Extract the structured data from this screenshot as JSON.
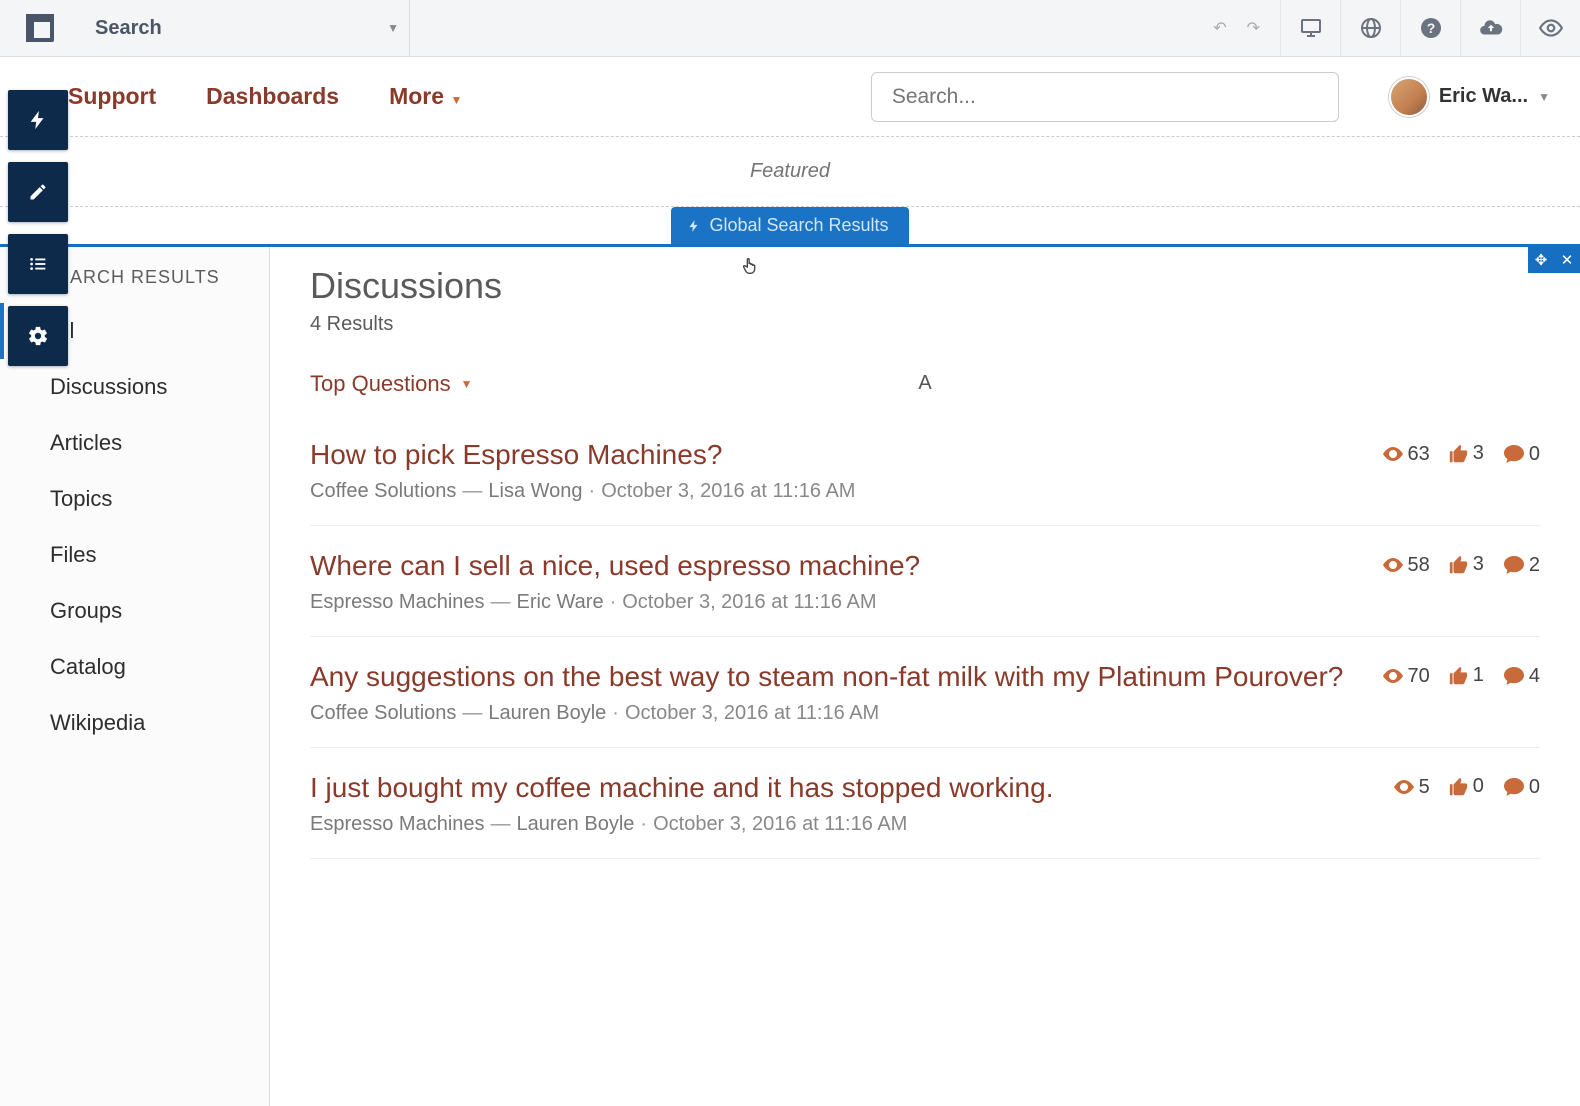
{
  "toolbar": {
    "search_label": "Search"
  },
  "nav": {
    "items": [
      "Support",
      "Dashboards",
      "More"
    ],
    "search_placeholder": "Search...",
    "user_name": "Eric Wa..."
  },
  "featured_label": "Featured",
  "gsr_label": "Global Search Results",
  "sidebar": {
    "title": "ARCH RESULTS",
    "items": [
      "All",
      "Discussions",
      "Articles",
      "Topics",
      "Files",
      "Groups",
      "Catalog",
      "Wikipedia"
    ]
  },
  "results": {
    "heading": "Discussions",
    "count_text": "4 Results",
    "sort_label": "Top Questions",
    "letter": "A",
    "items": [
      {
        "title": "How to pick Espresso Machines?",
        "space": "Coffee Solutions",
        "author": "Lisa Wong",
        "date": "October 3, 2016 at 11:16 AM",
        "views": 63,
        "likes": 3,
        "comments": 0
      },
      {
        "title": "Where can I sell a nice, used espresso machine?",
        "space": "Espresso Machines",
        "author": "Eric Ware",
        "date": "October 3, 2016 at 11:16 AM",
        "views": 58,
        "likes": 3,
        "comments": 2
      },
      {
        "title": "Any suggestions on the best way to steam non-fat milk with my Platinum Pourover?",
        "space": "Coffee Solutions",
        "author": "Lauren Boyle",
        "date": "October 3, 2016 at 11:16 AM",
        "views": 70,
        "likes": 1,
        "comments": 4
      },
      {
        "title": "I just bought my coffee machine and it has stopped working.",
        "space": "Espresso Machines",
        "author": "Lauren Boyle",
        "date": "October 3, 2016 at 11:16 AM",
        "views": 5,
        "likes": 0,
        "comments": 0
      }
    ]
  }
}
